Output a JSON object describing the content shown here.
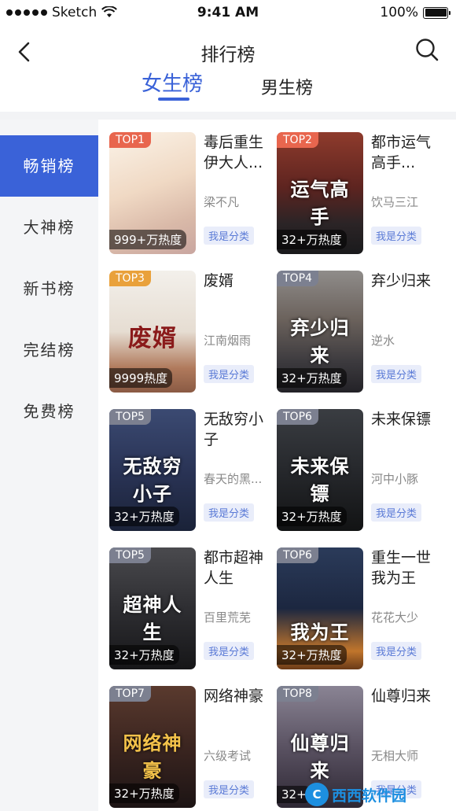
{
  "status_bar": {
    "carrier": "Sketch",
    "time": "9:41 AM",
    "battery": "100%"
  },
  "nav": {
    "title": "排行榜",
    "back_icon": "chevron-left-icon",
    "search_icon": "search-icon"
  },
  "gender_tabs": {
    "female": "女生榜",
    "male": "男生榜",
    "active": "female"
  },
  "sidebar": {
    "items": [
      {
        "label": "畅销榜",
        "active": true
      },
      {
        "label": "大神榜",
        "active": false
      },
      {
        "label": "新书榜",
        "active": false
      },
      {
        "label": "完结榜",
        "active": false
      },
      {
        "label": "免费榜",
        "active": false
      }
    ]
  },
  "books": [
    {
      "rank": "TOP1",
      "title": "毒后重生伊大人...",
      "author": "梁不凡",
      "heat": "999+万热度",
      "tag": "我是分类",
      "cover_text": "",
      "rank_color": "#e8664e",
      "cover_color": "#f1e4d6"
    },
    {
      "rank": "TOP2",
      "title": "都市运气高手...",
      "author": "饮马三江",
      "heat": "32+万热度",
      "tag": "我是分类",
      "cover_text": "运气高手",
      "rank_color": "#e8664e",
      "cover_color": "#6a2d22"
    },
    {
      "rank": "TOP3",
      "title": "废婿",
      "author": "江南烟雨",
      "heat": "9999热度",
      "tag": "我是分类",
      "cover_text": "废婿",
      "rank_color": "#e9a13b",
      "cover_color": "#e9e5df"
    },
    {
      "rank": "TOP4",
      "title": "弃少归来",
      "author": "逆水",
      "heat": "32+万热度",
      "tag": "我是分类",
      "cover_text": "弃少归来",
      "rank_color": "#7c8090",
      "cover_color": "#4b4a50"
    },
    {
      "rank": "TOP5",
      "title": "无敌穷小子",
      "author": "春天的黑...",
      "heat": "32+万热度",
      "tag": "我是分类",
      "cover_text": "无敌穷小子",
      "rank_color": "#7c8090",
      "cover_color": "#2a3550"
    },
    {
      "rank": "TOP6",
      "title": "未来保镖",
      "author": "河中小豚",
      "heat": "32+万热度",
      "tag": "我是分类",
      "cover_text": "未来保镖",
      "rank_color": "#7c8090",
      "cover_color": "#1f2124"
    },
    {
      "rank": "TOP5",
      "title": "都市超神人生",
      "author": "百里荒芜",
      "heat": "32+万热度",
      "tag": "我是分类",
      "cover_text": "超神人生",
      "rank_color": "#7c8090",
      "cover_color": "#2b2b2f"
    },
    {
      "rank": "TOP6",
      "title": "重生一世我为王",
      "author": "花花大少",
      "heat": "32+万热度",
      "tag": "我是分类",
      "cover_text": "我为王",
      "rank_color": "#7c8090",
      "cover_color": "#1c2a40"
    },
    {
      "rank": "TOP7",
      "title": "网络神豪",
      "author": "六级考试",
      "heat": "32+万热度",
      "tag": "我是分类",
      "cover_text": "网络神豪",
      "rank_color": "#7c8090",
      "cover_color": "#3b2a24"
    },
    {
      "rank": "TOP8",
      "title": "仙尊归来",
      "author": "无相大师",
      "heat": "32+",
      "tag": "我是分类",
      "cover_text": "仙尊归来",
      "rank_color": "#7c8090",
      "cover_color": "#4a4452"
    }
  ],
  "watermark": {
    "text": "西西软件园",
    "sub": "CR173.COM"
  }
}
